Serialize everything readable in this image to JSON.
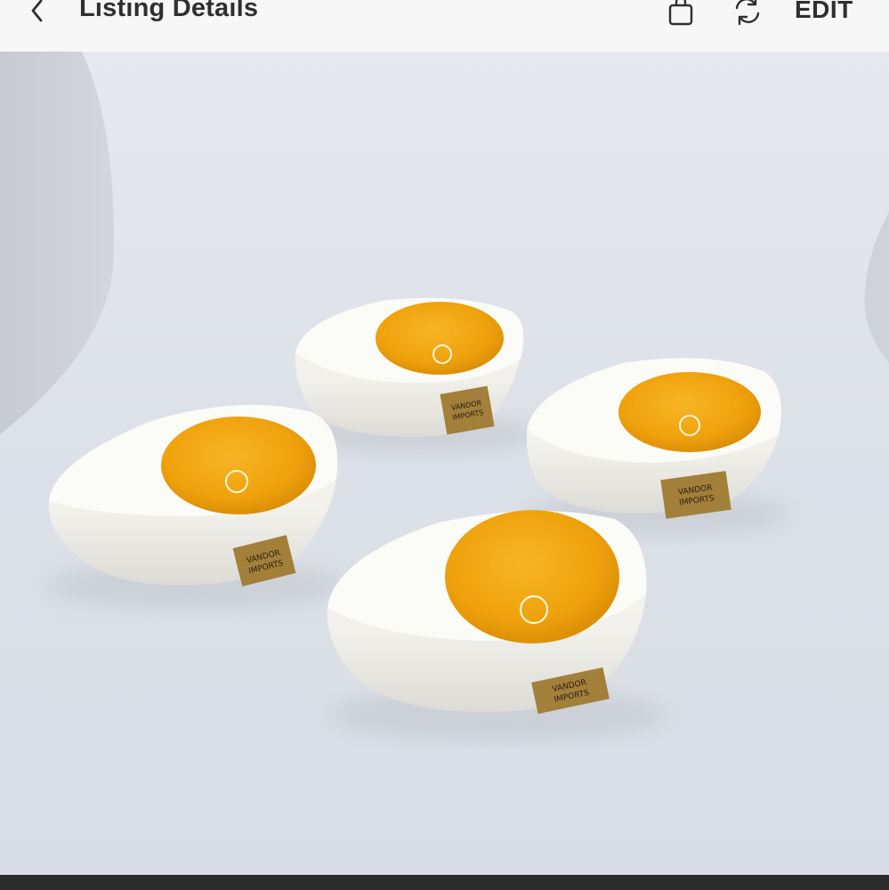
{
  "header": {
    "title": "Listing Details",
    "edit_label": "EDIT",
    "back_icon": "chevron-left-icon",
    "bag_icon": "shopping-bag-icon",
    "share_icon": "refresh-icon"
  },
  "photo": {
    "label_text": [
      "VANDOR",
      "IMPORTS"
    ]
  },
  "colors": {
    "header_bg": "#f7f7f7",
    "text": "#2f2f2f",
    "yolk": "#f2a50d",
    "ceramic": "#f4f3ee",
    "backdrop": "#dfe3e9",
    "bottom_bar": "#2b2b2b"
  }
}
